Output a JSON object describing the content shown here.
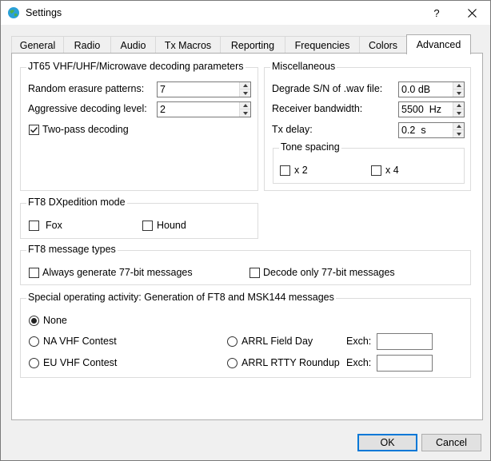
{
  "window": {
    "title": "Settings",
    "help_label": "?"
  },
  "tabs": [
    {
      "label": "General",
      "active": false
    },
    {
      "label": "Radio",
      "active": false
    },
    {
      "label": "Audio",
      "active": false
    },
    {
      "label": "Tx Macros",
      "active": false
    },
    {
      "label": "Reporting",
      "active": false
    },
    {
      "label": "Frequencies",
      "active": false
    },
    {
      "label": "Colors",
      "active": false
    },
    {
      "label": "Advanced",
      "active": true
    }
  ],
  "jt65": {
    "title": "JT65 VHF/UHF/Microwave decoding parameters",
    "random_erasure_label": "Random erasure patterns:",
    "random_erasure_value": "7",
    "aggressive_label": "Aggressive decoding level:",
    "aggressive_value": "2",
    "two_pass_label": "Two-pass decoding",
    "two_pass_checked": true
  },
  "misc": {
    "title": "Miscellaneous",
    "degrade_label": "Degrade S/N of .wav file:",
    "degrade_value": "0.0 dB",
    "bandwidth_label": "Receiver bandwidth:",
    "bandwidth_value": "5500  Hz",
    "tx_delay_label": "Tx delay:",
    "tx_delay_value": "0.2  s",
    "tone_spacing": {
      "title": "Tone spacing",
      "x2_label": "x 2",
      "x2_checked": false,
      "x4_label": "x 4",
      "x4_checked": false
    }
  },
  "dxpedition": {
    "title": "FT8 DXpedition mode",
    "fox_label": "Fox",
    "fox_checked": false,
    "hound_label": "Hound",
    "hound_checked": false
  },
  "ft8_msg": {
    "title": "FT8 message types",
    "always77_label": "Always generate 77-bit messages",
    "always77_checked": false,
    "decode77_label": "Decode only 77-bit messages",
    "decode77_checked": false
  },
  "special": {
    "title": "Special operating activity:  Generation of FT8 and MSK144 messages",
    "none_label": "None",
    "na_vhf_label": "NA VHF Contest",
    "eu_vhf_label": "EU VHF Contest",
    "arrl_field_label": "ARRL Field Day",
    "arrl_rtty_label": "ARRL RTTY Roundup",
    "exch_label": "Exch:",
    "selected": "None",
    "field_day_exch": "",
    "rtty_exch": ""
  },
  "buttons": {
    "ok": "OK",
    "cancel": "Cancel"
  },
  "colors": {
    "accent": "#0078d7"
  }
}
